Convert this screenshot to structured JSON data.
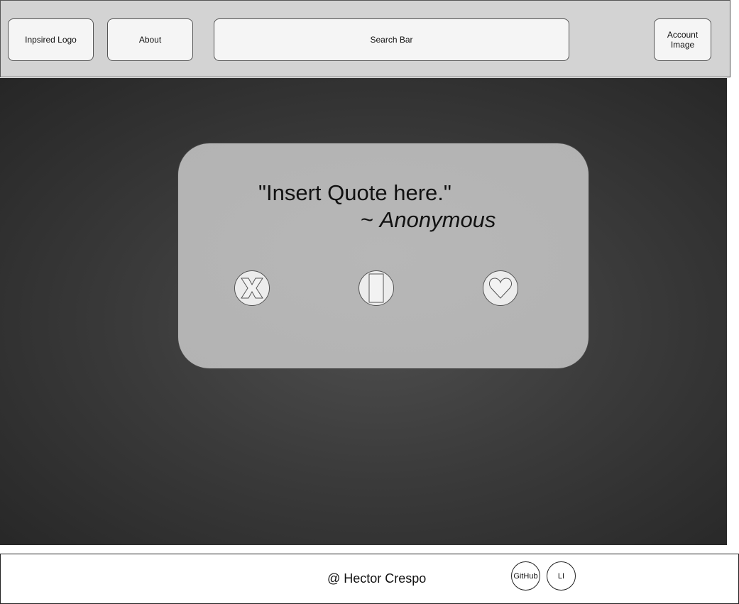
{
  "header": {
    "logo_label": "Inpsired Logo",
    "about_label": "About",
    "search_label": "Search Bar",
    "account_label": "Account\nImage"
  },
  "card": {
    "quote": "\"Insert Quote here.\"",
    "author_prefix": "~ ",
    "author_name": "Anonymous",
    "buttons": {
      "dismiss_icon": "x-icon",
      "middle_icon": "rectangle-icon",
      "like_icon": "heart-icon"
    }
  },
  "footer": {
    "copyright": "@ Hector Crespo",
    "github_label": "GitHub",
    "linkedin_label": "LI"
  },
  "colors": {
    "header_bg": "#d3d3d3",
    "card_bg": "#b5b5b5",
    "main_bg_center": "#4e4e4e",
    "main_bg_edge": "#262626"
  }
}
